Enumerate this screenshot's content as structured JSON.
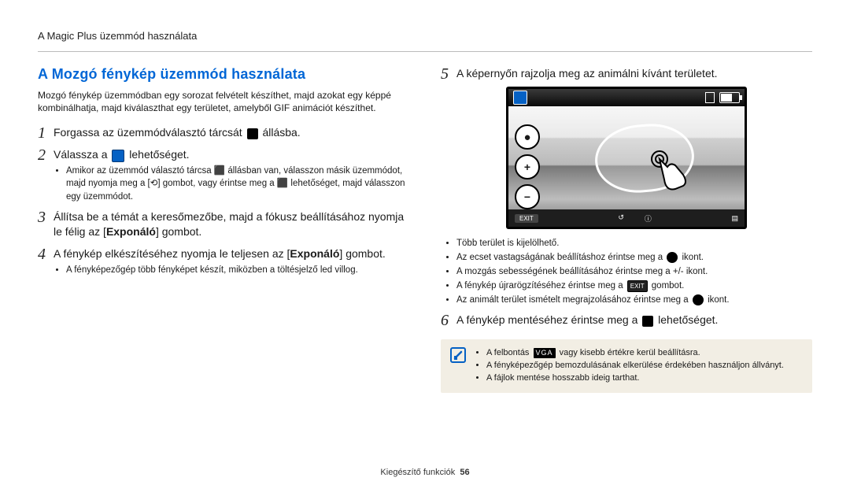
{
  "header": {
    "chapter": "A Magic Plus üzemmód használata"
  },
  "left": {
    "title": "A Mozgó fénykép üzemmód használata",
    "intro": "Mozgó fénykép üzemmódban egy sorozat felvételt készíthet, majd azokat egy képpé kombinálhatja, majd kiválaszthat egy területet, amelyből GIF animációt készíthet.",
    "step1_a": "Forgassa az üzemmódválasztó tárcsát ",
    "step1_b": " állásba.",
    "step2_a": "Válassza a ",
    "step2_b": " lehetőséget.",
    "step2_bullets": [
      "Amikor az üzemmód választó tárcsa ⬛ állásban van, válasszon másik üzemmódot, majd nyomja meg a [⟲] gombot, vagy érintse meg a ⬛ lehetőséget, majd válasszon egy üzemmódot."
    ],
    "step3_a": "Állítsa be a témát a keresőmezőbe, majd a fókusz beállításához nyomja le félig az [",
    "step3_b": "Exponáló",
    "step3_c": "] gombot.",
    "step4_a": "A fénykép elkészítéséhez nyomja le teljesen az [",
    "step4_b": "Exponáló",
    "step4_c": "] gombot.",
    "step4_bullets": [
      "A fényképezőgép több fényképet készít, miközben a töltésjelző led villog."
    ]
  },
  "right": {
    "step5": "A képernyőn rajzolja meg az animálni kívánt területet.",
    "step5_bullets_a": "Több terület is kijelölhető.",
    "step5_bullets_b_pre": "Az ecset vastagságának beállításhoz érintse meg a ",
    "step5_bullets_b_post": " ikont.",
    "step5_bullets_c": "A mozgás sebességének beállításához érintse meg a +/- ikont.",
    "step5_bullets_d_pre": "A fénykép újrarögzítéséhez érintse meg a ",
    "step5_bullets_d_post": " gombot.",
    "step5_bullets_e_pre": "Az animált terület ismételt megrajzolásához érintse meg a ",
    "step5_bullets_e_post": " ikont.",
    "exit_label": "EXIT",
    "step6_a": "A fénykép mentéséhez érintse meg a ",
    "step6_b": " lehetőséget.",
    "note_items_a_pre": "A felbontás ",
    "note_items_a_mid": "VGA",
    "note_items_a_post": " vagy kisebb értékre kerül beállításra.",
    "note_items_b": "A fényképezőgép bemozdulásának elkerülése érdekében használjon állványt.",
    "note_items_c": "A fájlok mentése hosszabb ideig tarthat."
  },
  "camera_bottombar": {
    "exit": "EXIT"
  },
  "footer": {
    "label": "Kiegészítő funkciók",
    "page": "56"
  }
}
